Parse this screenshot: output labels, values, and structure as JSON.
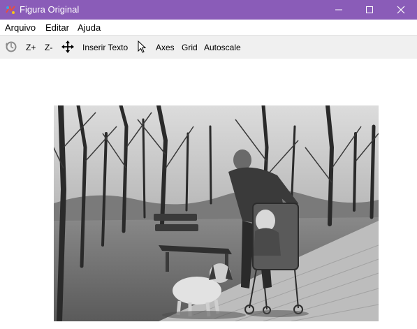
{
  "window": {
    "title": "Figura Original"
  },
  "menu": {
    "file": "Arquivo",
    "edit": "Editar",
    "help": "Ajuda"
  },
  "toolbar": {
    "zoom_in": "Z+",
    "zoom_out": "Z-",
    "insert_text": "Inserir Texto",
    "axes": "Axes",
    "grid": "Grid",
    "autoscale": "Autoscale"
  },
  "icons": {
    "app": "app-logo-icon",
    "reset": "reset-view-icon",
    "pan": "pan-move-icon",
    "pointer": "cursor-arrow-icon"
  },
  "colors": {
    "titlebar": "#8a5cb8",
    "toolbar": "#f0f0f0"
  }
}
